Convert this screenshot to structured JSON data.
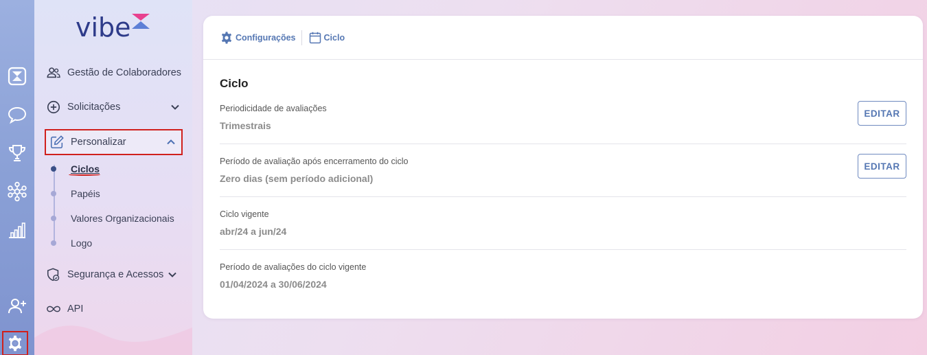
{
  "brand": {
    "name": "vibe"
  },
  "rail": {
    "items": [
      {
        "icon": "hourglass-icon"
      },
      {
        "icon": "chat-bubble-icon"
      },
      {
        "icon": "trophy-icon"
      },
      {
        "icon": "network-icon"
      },
      {
        "icon": "bar-chart-icon"
      },
      {
        "icon": "add-user-icon"
      },
      {
        "icon": "gear-icon"
      }
    ]
  },
  "sidebar": {
    "items": [
      {
        "label": "Gestão de Colaboradores",
        "icon": "people-icon"
      },
      {
        "label": "Solicitações",
        "icon": "plus-circle-icon"
      },
      {
        "label": "Personalizar",
        "icon": "edit-icon",
        "expanded": true
      },
      {
        "label": "Segurança e Acessos",
        "icon": "shield-lock-icon"
      },
      {
        "label": "API",
        "icon": "infinity-icon"
      }
    ],
    "subitems": [
      {
        "label": "Ciclos",
        "active": true
      },
      {
        "label": "Papéis"
      },
      {
        "label": "Valores Organizacionais"
      },
      {
        "label": "Logo"
      }
    ]
  },
  "breadcrumb": [
    {
      "label": "Configurações",
      "icon": "gear-icon"
    },
    {
      "label": "Ciclo",
      "icon": "calendar-icon"
    }
  ],
  "main": {
    "title": "Ciclo",
    "edit_label": "EDITAR",
    "settings": [
      {
        "label": "Periodicidade de avaliações",
        "value": "Trimestrais",
        "editable": true
      },
      {
        "label": "Período de avaliação após encerramento do ciclo",
        "value": "Zero dias (sem período adicional)",
        "editable": true
      },
      {
        "label": "Ciclo vigente",
        "value": "abr/24 a jun/24",
        "editable": false
      },
      {
        "label": "Período de avaliações do ciclo vigente",
        "value": "01/04/2024 a 30/06/2024",
        "editable": false
      }
    ]
  },
  "colors": {
    "accent": "#5577b3",
    "brand_navy": "#2e3b8a",
    "highlight_red": "#d0201c"
  }
}
